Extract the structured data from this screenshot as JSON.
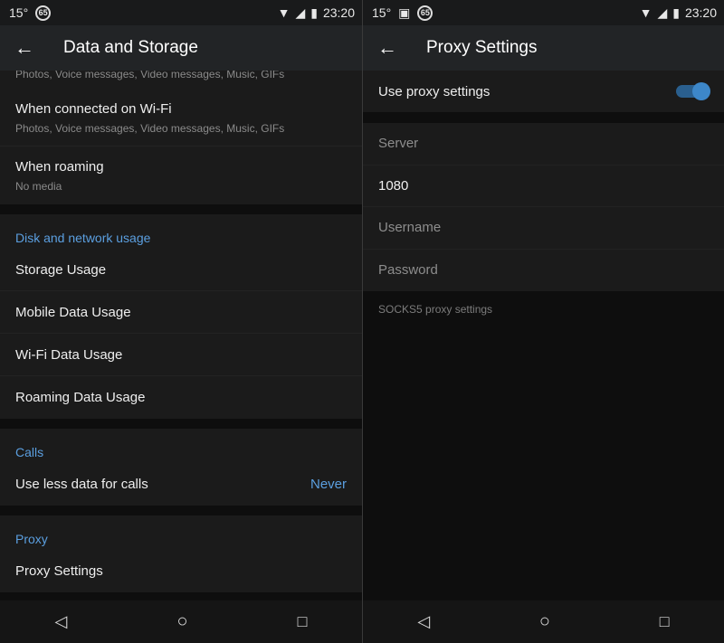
{
  "status": {
    "temp": "15°",
    "badge": "65",
    "time": "23:20"
  },
  "left": {
    "title": "Data and Storage",
    "partial_sub": "Photos, Voice messages, Video messages, Music, GIFs",
    "auto": [
      {
        "label": "When connected on Wi-Fi",
        "sub": "Photos, Voice messages, Video messages, Music, GIFs"
      },
      {
        "label": "When roaming",
        "sub": "No media"
      }
    ],
    "disk": {
      "header": "Disk and network usage",
      "items": [
        "Storage Usage",
        "Mobile Data Usage",
        "Wi-Fi Data Usage",
        "Roaming Data Usage"
      ]
    },
    "calls": {
      "header": "Calls",
      "label": "Use less data for calls",
      "value": "Never"
    },
    "proxy": {
      "header": "Proxy",
      "label": "Proxy Settings"
    }
  },
  "right": {
    "title": "Proxy Settings",
    "use_proxy": {
      "label": "Use proxy settings",
      "enabled": true
    },
    "fields": {
      "server_placeholder": "Server",
      "port_value": "1080",
      "username_placeholder": "Username",
      "password_placeholder": "Password"
    },
    "hint": "SOCKS5 proxy settings"
  },
  "colors": {
    "accent": "#5b9fe0",
    "toggle": "#3d87c9"
  }
}
